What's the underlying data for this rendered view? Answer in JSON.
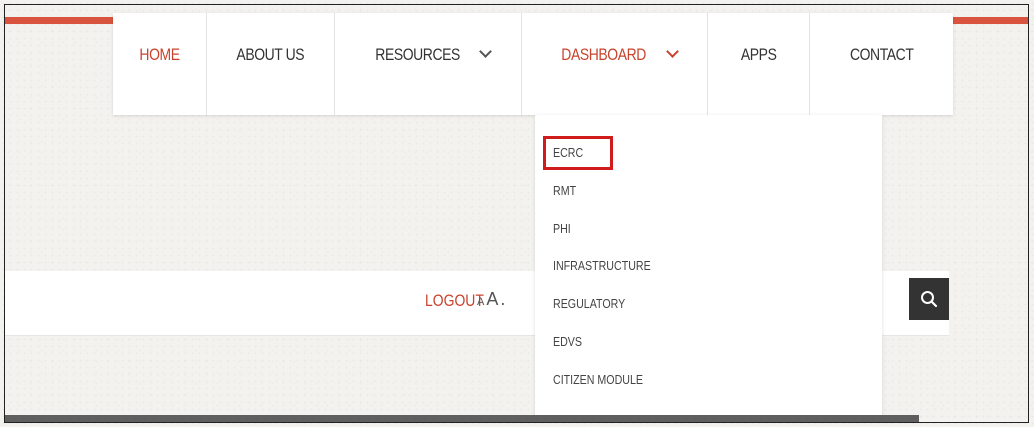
{
  "nav": {
    "items": [
      {
        "label": "HOME"
      },
      {
        "label": "ABOUT US"
      },
      {
        "label": "RESOURCES"
      },
      {
        "label": "DASHBOARD"
      },
      {
        "label": "APPS"
      },
      {
        "label": "CONTACT"
      }
    ]
  },
  "dropdown": {
    "items": [
      {
        "label": "ECRC"
      },
      {
        "label": "RMT"
      },
      {
        "label": "PHI"
      },
      {
        "label": "INFRASTRUCTURE"
      },
      {
        "label": "REGULATORY"
      },
      {
        "label": "EDVS"
      },
      {
        "label": "CITIZEN MODULE"
      }
    ]
  },
  "utility": {
    "logout_label": "LOGOUT",
    "font_small": "A",
    "font_large": "A",
    "font_large_suffix": "."
  },
  "icons": {
    "search": "search-icon",
    "chevron": "chevron-down-icon"
  },
  "colors": {
    "accent": "#d8543e",
    "highlight": "#d11c1c",
    "dark": "#333333"
  }
}
